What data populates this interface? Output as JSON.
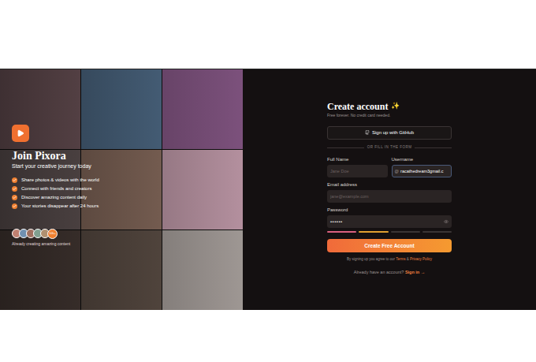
{
  "hero": {
    "title": "Join Pixora",
    "subtitle": "Start your creative journey today",
    "features": [
      "Share photos & videos with the world",
      "Connect with friends and creators",
      "Discover amazing content daily",
      "Your stories disappear after 24 hours"
    ],
    "avatar_count": "10k+",
    "caption": "Already creating amazing content"
  },
  "form": {
    "title": "Create account",
    "sparkle": "✨",
    "subtitle": "Free forever. No credit card needed.",
    "github_button": "Sign up with GitHub",
    "divider": "OR FILL IN THE FORM",
    "full_name": {
      "label": "Full Name",
      "placeholder": "Jane Doe"
    },
    "username": {
      "label": "Username",
      "prefix": "@",
      "value": "racathedream3gmail.c"
    },
    "email": {
      "label": "Email address",
      "placeholder": "jane@example.com"
    },
    "password": {
      "label": "Password",
      "value": "••••••",
      "strength": [
        {
          "filled": true,
          "color": "#d9607f"
        },
        {
          "filled": true,
          "color": "#e0a030"
        },
        {
          "filled": false,
          "color": "#3a3434"
        },
        {
          "filled": false,
          "color": "#3a3434"
        }
      ]
    },
    "submit": "Create Free Account",
    "terms": {
      "prefix": "By signing up you agree to our",
      "terms": "Terms",
      "and": "&",
      "privacy": "Privacy Policy"
    },
    "signin": {
      "prompt": "Already have an account?",
      "link": "Sign in →"
    }
  }
}
